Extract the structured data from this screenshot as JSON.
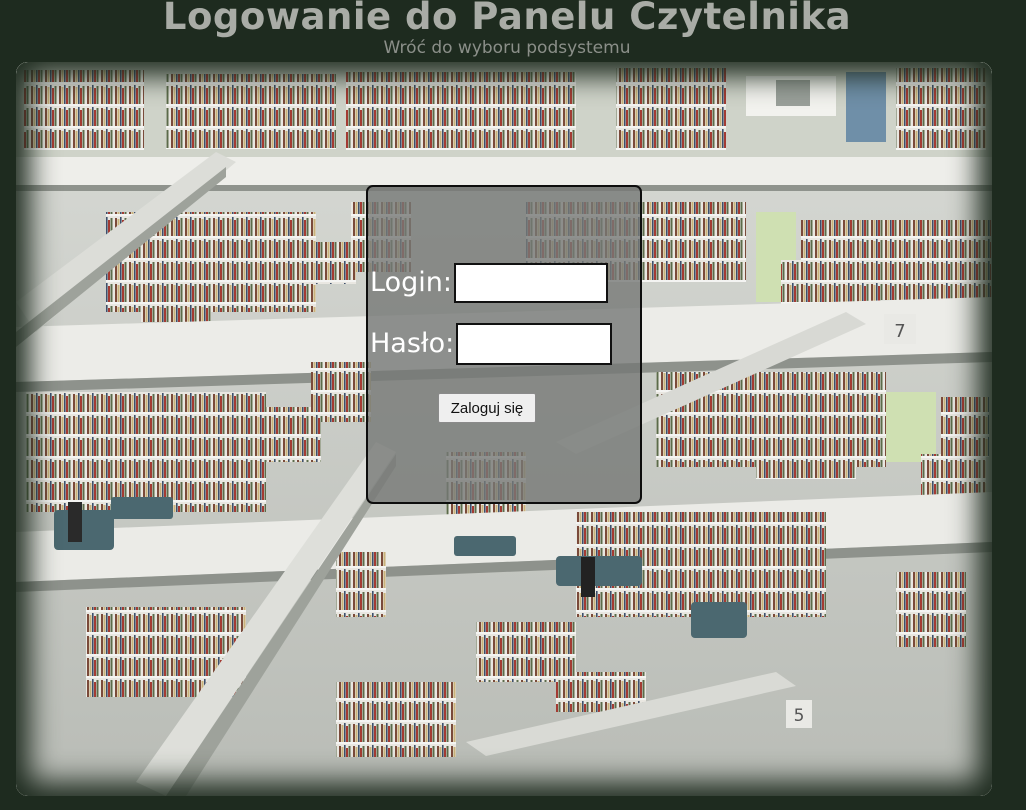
{
  "header": {
    "title": "Logowanie do Panelu Czytelnika",
    "back_link": "Wróć do wyboru podsystemu"
  },
  "login_form": {
    "login_label": "Login:",
    "login_value": "",
    "password_label": "Hasło:",
    "password_value": "",
    "submit_label": "Zaloguj się"
  },
  "background": {
    "image_subject": "library-atrium-photo",
    "floor_numbers": [
      "7",
      "5"
    ]
  },
  "colors": {
    "page_background": "#1e2b1f",
    "title_color": "#a9aca6",
    "panel_background": "rgba(118,120,118,0.80)"
  }
}
